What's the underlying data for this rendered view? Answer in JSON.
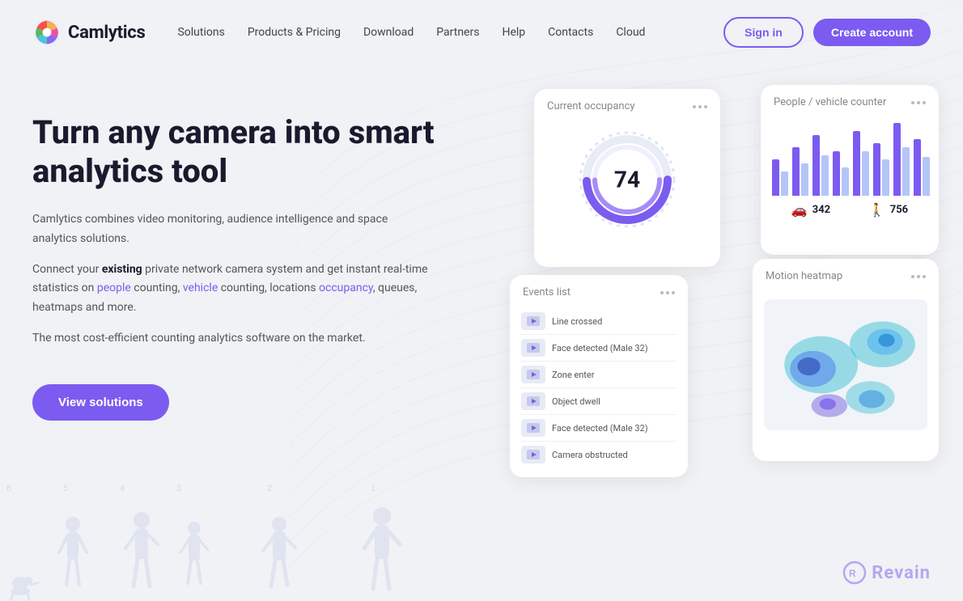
{
  "logo": {
    "name": "Camlytics",
    "icon_alt": "camlytics-logo"
  },
  "nav": {
    "items": [
      {
        "label": "Solutions",
        "id": "solutions"
      },
      {
        "label": "Products & Pricing",
        "id": "products-pricing"
      },
      {
        "label": "Download",
        "id": "download"
      },
      {
        "label": "Partners",
        "id": "partners"
      },
      {
        "label": "Help",
        "id": "help"
      },
      {
        "label": "Contacts",
        "id": "contacts"
      },
      {
        "label": "Cloud",
        "id": "cloud"
      }
    ]
  },
  "header": {
    "signin_label": "Sign in",
    "create_account_label": "Create account"
  },
  "hero": {
    "title": "Turn any camera into smart analytics tool",
    "desc1": "Camlytics combines video monitoring, audience intelligence and space analytics solutions.",
    "desc2_prefix": "Connect your ",
    "desc2_bold": "existing",
    "desc2_mid": " private network camera system and get instant real-time statistics on ",
    "desc2_people": "people",
    "desc2_mid2": " counting, ",
    "desc2_vehicle": "vehicle",
    "desc2_mid3": " counting, locations ",
    "desc2_occupancy": "occupancy",
    "desc2_suffix": ", queues, heatmaps and more.",
    "desc3": "The most cost-efficient counting analytics software on the market.",
    "cta_label": "View solutions"
  },
  "occupancy_card": {
    "title": "Current occupancy",
    "value": "74"
  },
  "counter_card": {
    "title": "People / vehicle counter",
    "vehicle_count": "342",
    "people_count": "756",
    "bars": [
      {
        "blue": 45,
        "light": 30
      },
      {
        "blue": 60,
        "light": 40
      },
      {
        "blue": 75,
        "light": 50
      },
      {
        "blue": 55,
        "light": 35
      },
      {
        "blue": 80,
        "light": 55
      },
      {
        "blue": 65,
        "light": 45
      },
      {
        "blue": 90,
        "light": 60
      },
      {
        "blue": 70,
        "light": 48
      }
    ]
  },
  "events_card": {
    "title": "Events list",
    "items": [
      {
        "label": "Line crossed"
      },
      {
        "label": "Face detected (Male 32)"
      },
      {
        "label": "Zone enter"
      },
      {
        "label": "Object dwell"
      },
      {
        "label": "Face detected (Male 32)"
      },
      {
        "label": "Camera obstructed"
      }
    ]
  },
  "heatmap_card": {
    "title": "Motion heatmap"
  },
  "silhouettes": {
    "numbers": [
      "6",
      "5",
      "4",
      "3",
      "",
      "2",
      "",
      "1"
    ]
  },
  "watermark": {
    "text": "Revain"
  }
}
